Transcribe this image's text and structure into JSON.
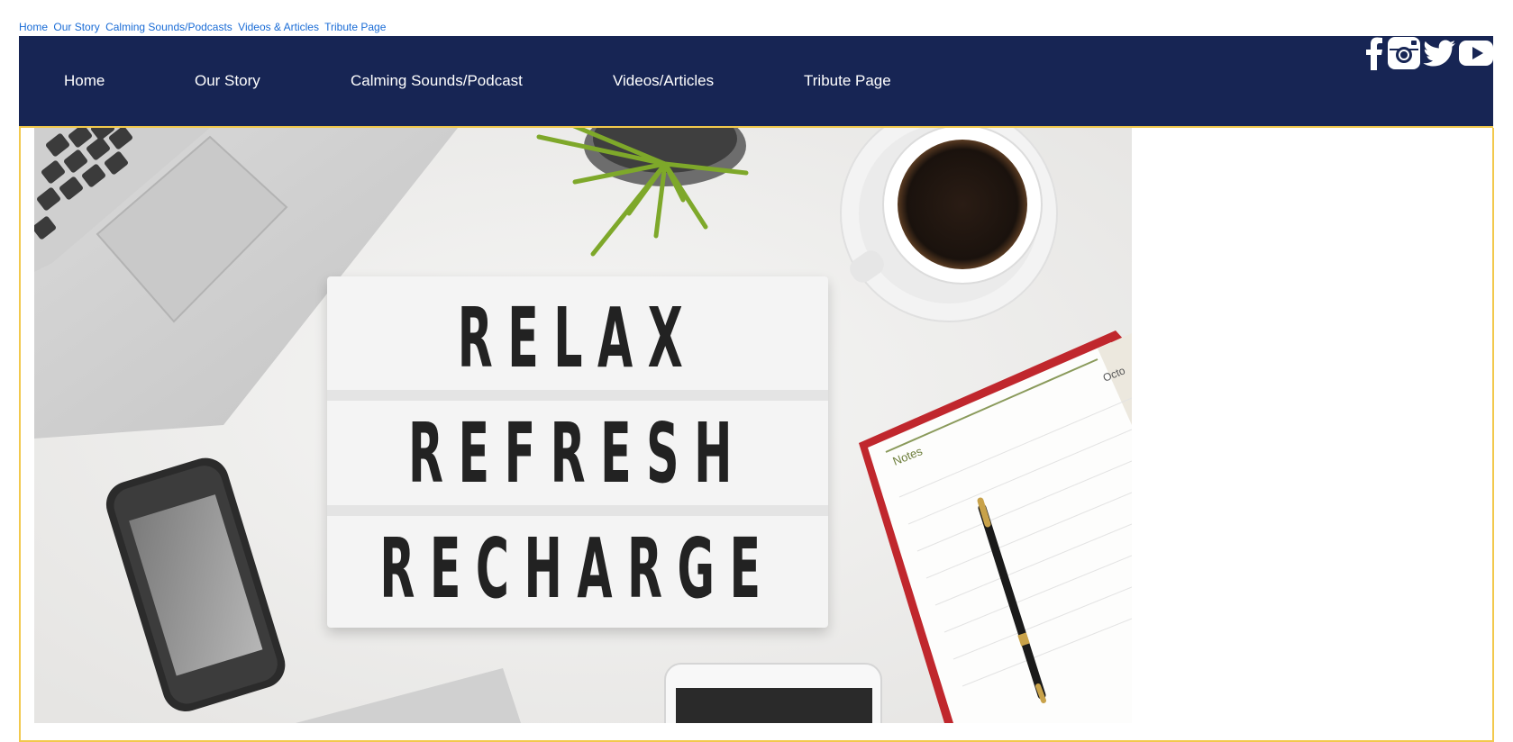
{
  "top_links": [
    "Home",
    "Our Story",
    "Calming Sounds/Podcasts",
    "Videos & Articles",
    "Tribute Page"
  ],
  "nav": {
    "items": [
      "Home",
      "Our Story",
      "Calming Sounds/Podcast",
      "Videos/Articles",
      "Tribute Page"
    ],
    "background_color": "#172554",
    "accent_color": "#f2c94c"
  },
  "social_icons": [
    "facebook-icon",
    "instagram-icon",
    "twitter-icon",
    "youtube-icon"
  ],
  "hero": {
    "lightbox_lines": [
      "RELAX",
      "REFRESH",
      "RECHARGE"
    ],
    "notebook_label": "Notes",
    "calendar_fragment": "Octo"
  },
  "colors": {
    "link": "#1a6cd6",
    "frame_border": "#f2c94c"
  }
}
